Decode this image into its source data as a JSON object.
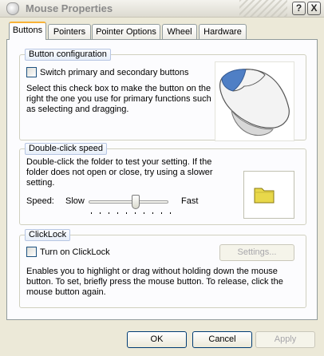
{
  "window": {
    "title": "Mouse Properties",
    "help_button": "?",
    "close_button": "X"
  },
  "tabs": [
    {
      "label": "Buttons",
      "active": true
    },
    {
      "label": "Pointers",
      "active": false
    },
    {
      "label": "Pointer Options",
      "active": false
    },
    {
      "label": "Wheel",
      "active": false
    },
    {
      "label": "Hardware",
      "active": false
    }
  ],
  "button_configuration": {
    "legend": "Button configuration",
    "checkbox_label": "Switch primary and secondary buttons",
    "checked": false,
    "description": "Select this check box to make the button on the right the one you use for primary functions such as selecting and dragging."
  },
  "double_click": {
    "legend": "Double-click speed",
    "description": "Double-click the folder to test your setting. If the folder does not open or close, try using a slower setting.",
    "speed_label": "Speed:",
    "slow_label": "Slow",
    "fast_label": "Fast",
    "speed_value_fraction": 0.6
  },
  "clicklock": {
    "legend": "ClickLock",
    "checkbox_label": "Turn on ClickLock",
    "checked": false,
    "settings_button": "Settings...",
    "description": "Enables you to highlight or drag without holding down the mouse button. To set, briefly press the mouse button. To release, click the mouse button again."
  },
  "footer": {
    "ok": "OK",
    "cancel": "Cancel",
    "apply": "Apply"
  },
  "colors": {
    "dialog_bg": "#ece9d8",
    "panel_bg": "#fcfcfe",
    "tab_highlight": "#f8b237",
    "folder": "#e8d84a"
  }
}
